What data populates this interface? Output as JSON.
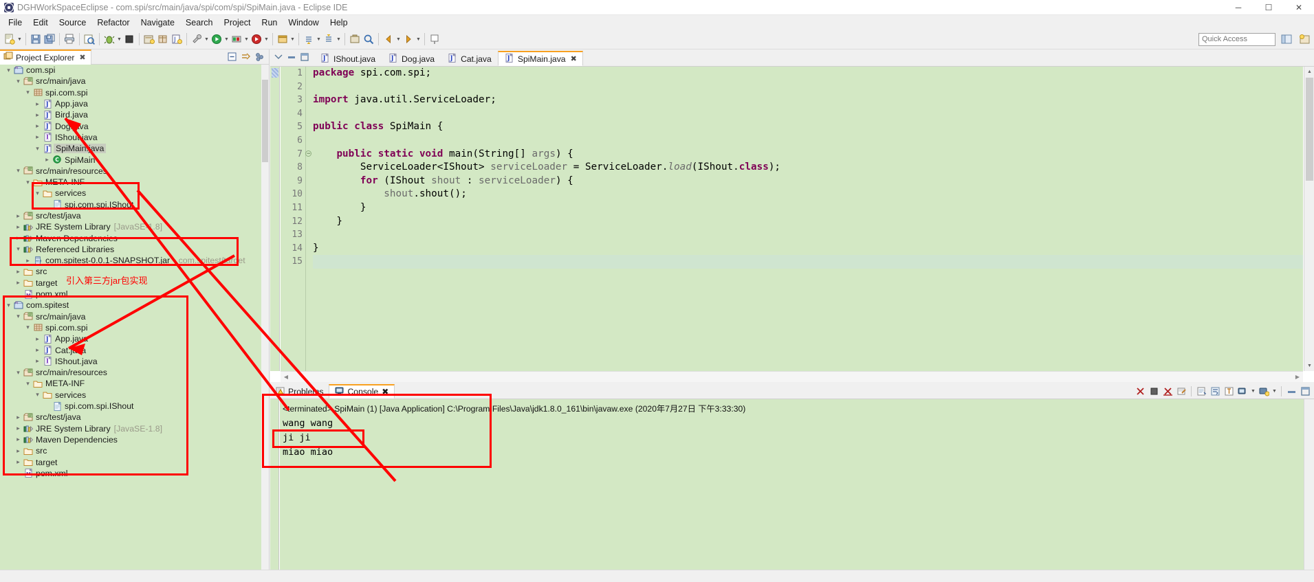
{
  "window": {
    "title": "DGHWorkSpaceEclipse - com.spi/src/main/java/spi/com/spi/SpiMain.java - Eclipse IDE",
    "minimize": "─",
    "maximize": "☐",
    "close": "✕"
  },
  "menubar": {
    "items": [
      "File",
      "Edit",
      "Source",
      "Refactor",
      "Navigate",
      "Search",
      "Project",
      "Run",
      "Window",
      "Help"
    ]
  },
  "toolbar": {
    "quick_access_placeholder": "Quick Access",
    "quick_access_value": ""
  },
  "project_explorer": {
    "tab_label": "Project Explorer",
    "close_glyph": "✖",
    "tools": [
      "collapse-all-icon",
      "link-with-editor-icon",
      "view-menu-icon"
    ],
    "tree": [
      {
        "depth": 0,
        "arrow": "open",
        "icon": "maven-project",
        "label": "com.spi",
        "sub": ""
      },
      {
        "depth": 1,
        "arrow": "open",
        "icon": "source-folder",
        "label": "src/main/java",
        "sub": ""
      },
      {
        "depth": 2,
        "arrow": "open",
        "icon": "package",
        "label": "spi.com.spi",
        "sub": ""
      },
      {
        "depth": 3,
        "arrow": "closed",
        "icon": "java-class",
        "label": "App.java",
        "sub": ""
      },
      {
        "depth": 3,
        "arrow": "closed",
        "icon": "java-class",
        "label": "Bird.java",
        "sub": ""
      },
      {
        "depth": 3,
        "arrow": "closed",
        "icon": "java-class",
        "label": "Dog.java",
        "sub": ""
      },
      {
        "depth": 3,
        "arrow": "closed",
        "icon": "java-interface",
        "label": "IShout.java",
        "sub": ""
      },
      {
        "depth": 3,
        "arrow": "open",
        "icon": "java-class",
        "label": "SpiMain.java",
        "sub": "",
        "selected": true
      },
      {
        "depth": 4,
        "arrow": "closed",
        "icon": "class-member",
        "label": "SpiMain",
        "sub": ""
      },
      {
        "depth": 1,
        "arrow": "open",
        "icon": "source-folder",
        "label": "src/main/resources",
        "sub": ""
      },
      {
        "depth": 2,
        "arrow": "open",
        "icon": "folder",
        "label": "META-INF",
        "sub": ""
      },
      {
        "depth": 3,
        "arrow": "open",
        "icon": "folder",
        "label": "services",
        "sub": ""
      },
      {
        "depth": 4,
        "arrow": "none",
        "icon": "file",
        "label": "spi.com.spi.IShout",
        "sub": ""
      },
      {
        "depth": 1,
        "arrow": "closed",
        "icon": "source-folder",
        "label": "src/test/java",
        "sub": ""
      },
      {
        "depth": 1,
        "arrow": "closed",
        "icon": "library",
        "label": "JRE System Library",
        "sub": "[JavaSE-1.8]"
      },
      {
        "depth": 1,
        "arrow": "closed",
        "icon": "library",
        "label": "Maven Dependencies",
        "sub": ""
      },
      {
        "depth": 1,
        "arrow": "open",
        "icon": "library",
        "label": "Referenced Libraries",
        "sub": ""
      },
      {
        "depth": 2,
        "arrow": "closed",
        "icon": "jar",
        "label": "com.spitest-0.0.1-SNAPSHOT.jar",
        "sub": "- com.spitest/target"
      },
      {
        "depth": 1,
        "arrow": "closed",
        "icon": "folder",
        "label": "src",
        "sub": ""
      },
      {
        "depth": 1,
        "arrow": "closed",
        "icon": "folder",
        "label": "target",
        "sub": ""
      },
      {
        "depth": 1,
        "arrow": "none",
        "icon": "pom",
        "label": "pom.xml",
        "sub": ""
      },
      {
        "depth": 0,
        "arrow": "open",
        "icon": "maven-project",
        "label": "com.spitest",
        "sub": ""
      },
      {
        "depth": 1,
        "arrow": "open",
        "icon": "source-folder",
        "label": "src/main/java",
        "sub": ""
      },
      {
        "depth": 2,
        "arrow": "open",
        "icon": "package",
        "label": "spi.com.spi",
        "sub": ""
      },
      {
        "depth": 3,
        "arrow": "closed",
        "icon": "java-class",
        "label": "App.java",
        "sub": ""
      },
      {
        "depth": 3,
        "arrow": "closed",
        "icon": "java-class",
        "label": "Cat.java",
        "sub": ""
      },
      {
        "depth": 3,
        "arrow": "closed",
        "icon": "java-interface",
        "label": "IShout.java",
        "sub": ""
      },
      {
        "depth": 1,
        "arrow": "open",
        "icon": "source-folder",
        "label": "src/main/resources",
        "sub": ""
      },
      {
        "depth": 2,
        "arrow": "open",
        "icon": "folder",
        "label": "META-INF",
        "sub": ""
      },
      {
        "depth": 3,
        "arrow": "open",
        "icon": "folder",
        "label": "services",
        "sub": ""
      },
      {
        "depth": 4,
        "arrow": "none",
        "icon": "file",
        "label": "spi.com.spi.IShout",
        "sub": ""
      },
      {
        "depth": 1,
        "arrow": "closed",
        "icon": "source-folder",
        "label": "src/test/java",
        "sub": ""
      },
      {
        "depth": 1,
        "arrow": "closed",
        "icon": "library",
        "label": "JRE System Library",
        "sub": "[JavaSE-1.8]"
      },
      {
        "depth": 1,
        "arrow": "closed",
        "icon": "library",
        "label": "Maven Dependencies",
        "sub": ""
      },
      {
        "depth": 1,
        "arrow": "closed",
        "icon": "folder",
        "label": "src",
        "sub": ""
      },
      {
        "depth": 1,
        "arrow": "closed",
        "icon": "folder",
        "label": "target",
        "sub": ""
      },
      {
        "depth": 1,
        "arrow": "none",
        "icon": "pom",
        "label": "pom.xml",
        "sub": ""
      }
    ]
  },
  "editor": {
    "tabs": [
      {
        "label": "IShout.java",
        "active": false,
        "closable": false
      },
      {
        "label": "Dog.java",
        "active": false,
        "closable": false
      },
      {
        "label": "Cat.java",
        "active": false,
        "closable": false
      },
      {
        "label": "SpiMain.java",
        "active": true,
        "closable": true
      }
    ],
    "close_glyph": "✖",
    "lines": [
      {
        "n": "1",
        "fold": false,
        "html": "<span class=\"kw\">package</span> spi.com.spi;"
      },
      {
        "n": "2",
        "fold": false,
        "html": ""
      },
      {
        "n": "3",
        "fold": false,
        "html": "<span class=\"kw\">import</span> java.util.ServiceLoader;"
      },
      {
        "n": "4",
        "fold": false,
        "html": ""
      },
      {
        "n": "5",
        "fold": false,
        "html": "<span class=\"kw\">public class</span> SpiMain {"
      },
      {
        "n": "6",
        "fold": false,
        "html": ""
      },
      {
        "n": "7",
        "fold": true,
        "html": "    <span class=\"kw\">public static void</span> main(String[] <span class=\"var\">args</span>) {"
      },
      {
        "n": "8",
        "fold": false,
        "html": "        ServiceLoader&lt;IShout&gt; <span class=\"var\">serviceLoader</span> = ServiceLoader.<span class=\"varit\">load</span>(IShout.<span class=\"kw\">class</span>);"
      },
      {
        "n": "9",
        "fold": false,
        "html": "        <span class=\"kw\">for</span> (IShout <span class=\"var\">shout</span> : <span class=\"var\">serviceLoader</span>) {"
      },
      {
        "n": "10",
        "fold": false,
        "html": "            <span class=\"var\">shout</span>.shout();"
      },
      {
        "n": "11",
        "fold": false,
        "html": "        }"
      },
      {
        "n": "12",
        "fold": false,
        "html": "    }"
      },
      {
        "n": "13",
        "fold": false,
        "html": ""
      },
      {
        "n": "14",
        "fold": false,
        "html": "}"
      },
      {
        "n": "15",
        "fold": false,
        "html": "",
        "current": true
      }
    ]
  },
  "console": {
    "tabs": [
      {
        "label": "Problems",
        "icon": "problems-icon",
        "active": false
      },
      {
        "label": "Console",
        "icon": "console-icon",
        "active": true
      }
    ],
    "close_glyph": "✖",
    "header": "<terminated> SpiMain (1) [Java Application] C:\\Program Files\\Java\\jdk1.8.0_161\\bin\\javaw.exe (2020年7月27日 下午3:33:30)",
    "output": [
      "wang wang",
      "ji ji",
      "miao miao"
    ],
    "tools": [
      "terminate-icon",
      "remove-launch-icon",
      "remove-all-terminated-icon",
      "clear-console-icon",
      "scroll-lock-icon",
      "word-wrap-icon",
      "pin-console-icon",
      "display-selected-console-icon",
      "open-console-icon",
      "minimize-icon",
      "maximize-icon"
    ]
  },
  "annotations": {
    "note_text": "引入第三方jar包实现",
    "color": "#ff0000"
  }
}
